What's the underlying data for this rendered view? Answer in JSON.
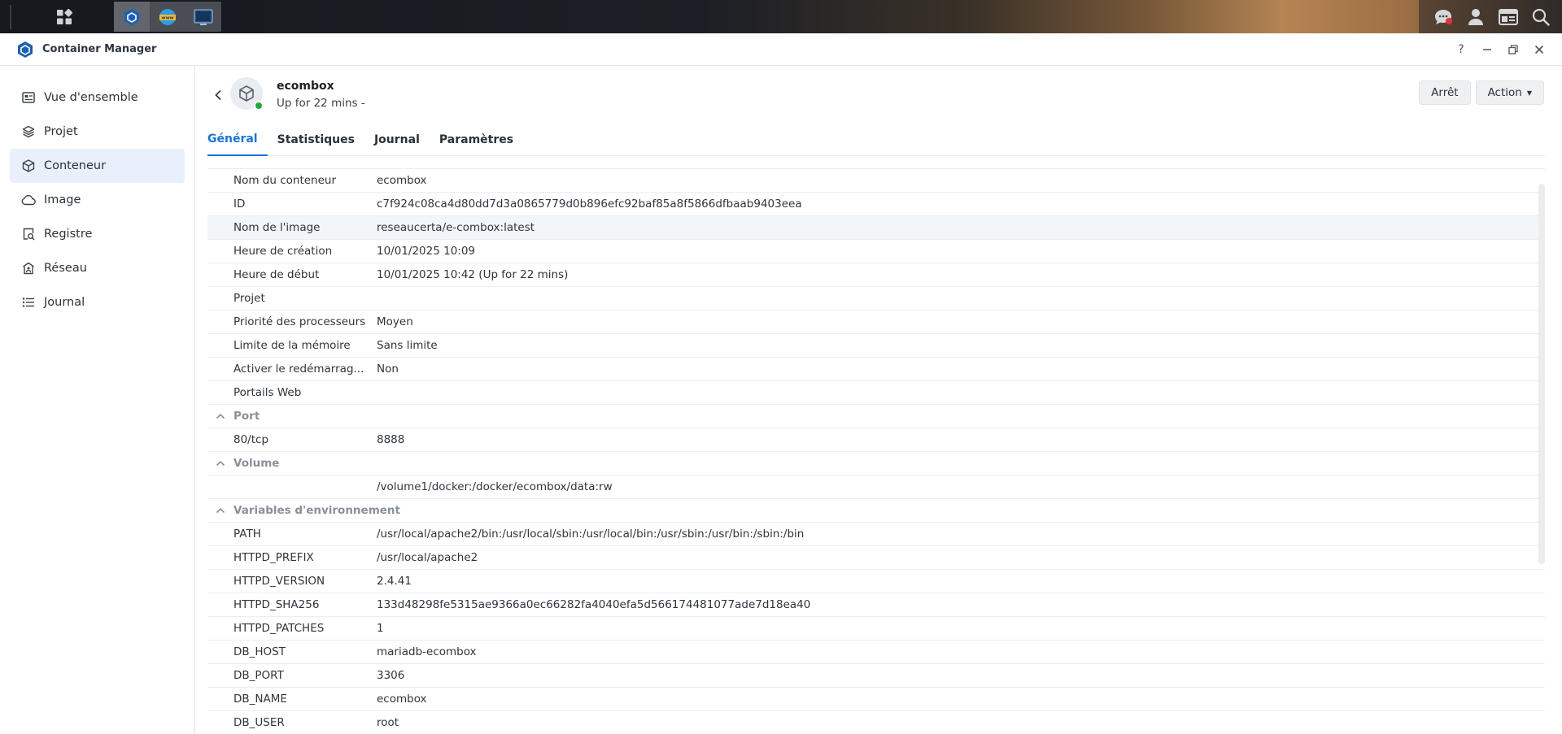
{
  "window": {
    "title": "Container Manager"
  },
  "window_controls": {
    "help": "?",
    "minimize": "–",
    "restore": "🗗",
    "close": "✕"
  },
  "sidebar": {
    "items": [
      {
        "label": "Vue d'ensemble",
        "icon": "overview-icon"
      },
      {
        "label": "Projet",
        "icon": "project-icon"
      },
      {
        "label": "Conteneur",
        "icon": "container-icon",
        "active": true
      },
      {
        "label": "Image",
        "icon": "cloud-icon"
      },
      {
        "label": "Registre",
        "icon": "registry-icon"
      },
      {
        "label": "Réseau",
        "icon": "network-icon"
      },
      {
        "label": "Journal",
        "icon": "list-icon"
      }
    ]
  },
  "container": {
    "name": "ecombox",
    "status": "Up for 22 mins -"
  },
  "actions": {
    "stop": "Arrêt",
    "action": "Action"
  },
  "tabs": [
    "Général",
    "Statistiques",
    "Journal",
    "Paramètres"
  ],
  "details": [
    {
      "k": "Nom du conteneur",
      "v": "ecombox"
    },
    {
      "k": "ID",
      "v": "c7f924c08ca4d80dd7d3a0865779d0b896efc92baf85a8f5866dfbaab9403eea"
    },
    {
      "k": "Nom de l'image",
      "v": "reseaucerta/e-combox:latest"
    },
    {
      "k": "Heure de création",
      "v": "10/01/2025 10:09"
    },
    {
      "k": "Heure de début",
      "v": "10/01/2025 10:42 (Up for 22 mins)"
    },
    {
      "k": "Projet",
      "v": ""
    },
    {
      "k": "Priorité des processeurs",
      "v": "Moyen"
    },
    {
      "k": "Limite de la mémoire",
      "v": "Sans limite"
    },
    {
      "k": "Activer le redémarrag...",
      "v": "Non"
    },
    {
      "k": "Portails Web",
      "v": ""
    }
  ],
  "sections": {
    "port": {
      "title": "Port",
      "rows": [
        {
          "k": "80/tcp",
          "v": "8888"
        }
      ]
    },
    "volume": {
      "title": "Volume",
      "rows": [
        {
          "k": "",
          "v": "/volume1/docker:/docker/ecombox/data:rw"
        }
      ]
    },
    "env": {
      "title": "Variables d'environnement",
      "rows": [
        {
          "k": "PATH",
          "v": "/usr/local/apache2/bin:/usr/local/sbin:/usr/local/bin:/usr/sbin:/usr/bin:/sbin:/bin"
        },
        {
          "k": "HTTPD_PREFIX",
          "v": "/usr/local/apache2"
        },
        {
          "k": "HTTPD_VERSION",
          "v": "2.4.41"
        },
        {
          "k": "HTTPD_SHA256",
          "v": "133d48298fe5315ae9366a0ec66282fa4040efa5d566174481077ade7d18ea40"
        },
        {
          "k": "HTTPD_PATCHES",
          "v": "1"
        },
        {
          "k": "DB_HOST",
          "v": "mariadb-ecombox"
        },
        {
          "k": "DB_PORT",
          "v": "3306"
        },
        {
          "k": "DB_NAME",
          "v": "ecombox"
        },
        {
          "k": "DB_USER",
          "v": "root"
        }
      ]
    }
  },
  "colors": {
    "accent": "#1a73d8",
    "running": "#23a83c",
    "active_nav_bg": "#e8f1fb"
  }
}
